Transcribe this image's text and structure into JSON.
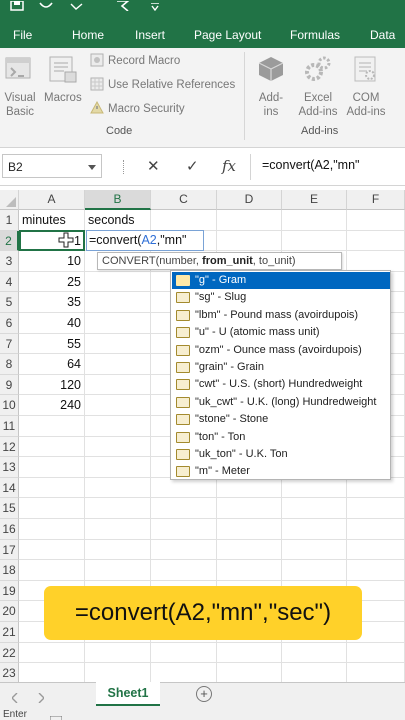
{
  "ribbon": {
    "tabs": [
      "File",
      "Home",
      "Insert",
      "Page Layout",
      "Formulas",
      "Data"
    ],
    "code_group": {
      "visual_basic_line1": "Visual",
      "visual_basic_line2": "Basic",
      "macros": "Macros",
      "record_macro": "Record Macro",
      "use_relative": "Use Relative References",
      "macro_security": "Macro Security",
      "label": "Code"
    },
    "addins_group": {
      "addins_line1": "Add-",
      "addins_line2": "ins",
      "excel_addins_line1": "Excel",
      "excel_addins_line2": "Add-ins",
      "com_addins_line1": "COM",
      "com_addins_line2": "Add-ins",
      "label": "Add-ins"
    }
  },
  "formula_bar": {
    "name_box": "B2",
    "cancel_symbol": "✕",
    "enter_symbol": "✓",
    "fx_symbol": "fx",
    "formula": "=convert(A2,\"mn\""
  },
  "grid": {
    "columns": [
      "A",
      "B",
      "C",
      "D",
      "E",
      "F"
    ],
    "rows": [
      "1",
      "2",
      "3",
      "4",
      "5",
      "6",
      "7",
      "8",
      "9",
      "10",
      "11",
      "12",
      "13",
      "14",
      "15",
      "16",
      "17",
      "18",
      "19",
      "20",
      "21",
      "22",
      "23"
    ],
    "header_a": "minutes",
    "header_b": "seconds",
    "minutes": [
      "1",
      "10",
      "25",
      "35",
      "40",
      "55",
      "64",
      "120",
      "240"
    ]
  },
  "edit_cell": {
    "prefix": "=convert(",
    "ref": "A2",
    "suffix": ",\"mn\""
  },
  "tooltip": {
    "fn": "CONVERT(number, ",
    "arg_bold": "from_unit",
    "rest": ", to_unit)"
  },
  "autocomplete": [
    "\"g\" - Gram",
    "\"sg\" - Slug",
    "\"lbm\" - Pound mass (avoirdupois)",
    "\"u\" - U (atomic mass unit)",
    "\"ozm\" - Ounce mass (avoirdupois)",
    "\"grain\" - Grain",
    "\"cwt\" - U.S. (short) Hundredweight",
    "\"uk_cwt\" - U.K. (long) Hundredweight",
    "\"stone\" - Stone",
    "\"ton\" - Ton",
    "\"uk_ton\" - U.K. Ton",
    "\"m\" - Meter"
  ],
  "banner": "=convert(A2,\"mn\",\"sec\")",
  "sheet_tab": "Sheet1",
  "add_sheet": "+",
  "status": "Enter",
  "colors": {
    "excel_green": "#217346",
    "highlight_blue": "#0067c0",
    "banner_yellow": "#ffd129",
    "ref_blue": "#2f6fd6"
  }
}
